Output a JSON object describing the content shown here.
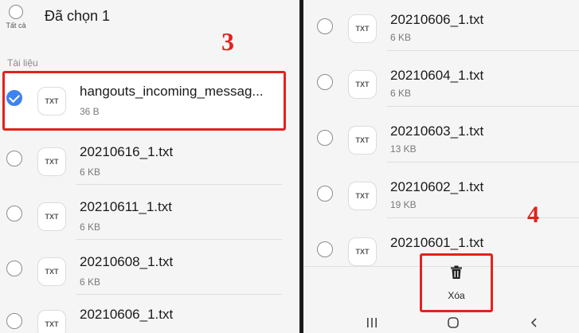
{
  "left": {
    "select_all_label": "Tất cả",
    "selected_title": "Đã chọn 1",
    "section_label": "Tài liệu",
    "files": [
      {
        "name": "hangouts_incoming_messag...",
        "size": "36 B",
        "checked": true,
        "icon": "TXT"
      },
      {
        "name": "20210616_1.txt",
        "size": "6 KB",
        "checked": false,
        "icon": "TXT"
      },
      {
        "name": "20210611_1.txt",
        "size": "6 KB",
        "checked": false,
        "icon": "TXT"
      },
      {
        "name": "20210608_1.txt",
        "size": "6 KB",
        "checked": false,
        "icon": "TXT"
      },
      {
        "name": "20210606_1.txt",
        "size": "",
        "checked": false,
        "icon": "TXT"
      }
    ]
  },
  "right": {
    "files": [
      {
        "name": "20210606_1.txt",
        "size": "6 KB",
        "icon": "TXT"
      },
      {
        "name": "20210604_1.txt",
        "size": "6 KB",
        "icon": "TXT"
      },
      {
        "name": "20210603_1.txt",
        "size": "13 KB",
        "icon": "TXT"
      },
      {
        "name": "20210602_1.txt",
        "size": "19 KB",
        "icon": "TXT"
      },
      {
        "name": "20210601_1.txt",
        "size": "",
        "icon": "TXT"
      }
    ],
    "delete_label": "Xóa",
    "nav_icons": [
      "recent-apps-icon",
      "home-icon",
      "back-icon"
    ]
  },
  "callouts": {
    "step_3": "3",
    "step_4": "4"
  },
  "colors": {
    "accent": "#3e82f0",
    "annotation_red": "#e2231a"
  }
}
